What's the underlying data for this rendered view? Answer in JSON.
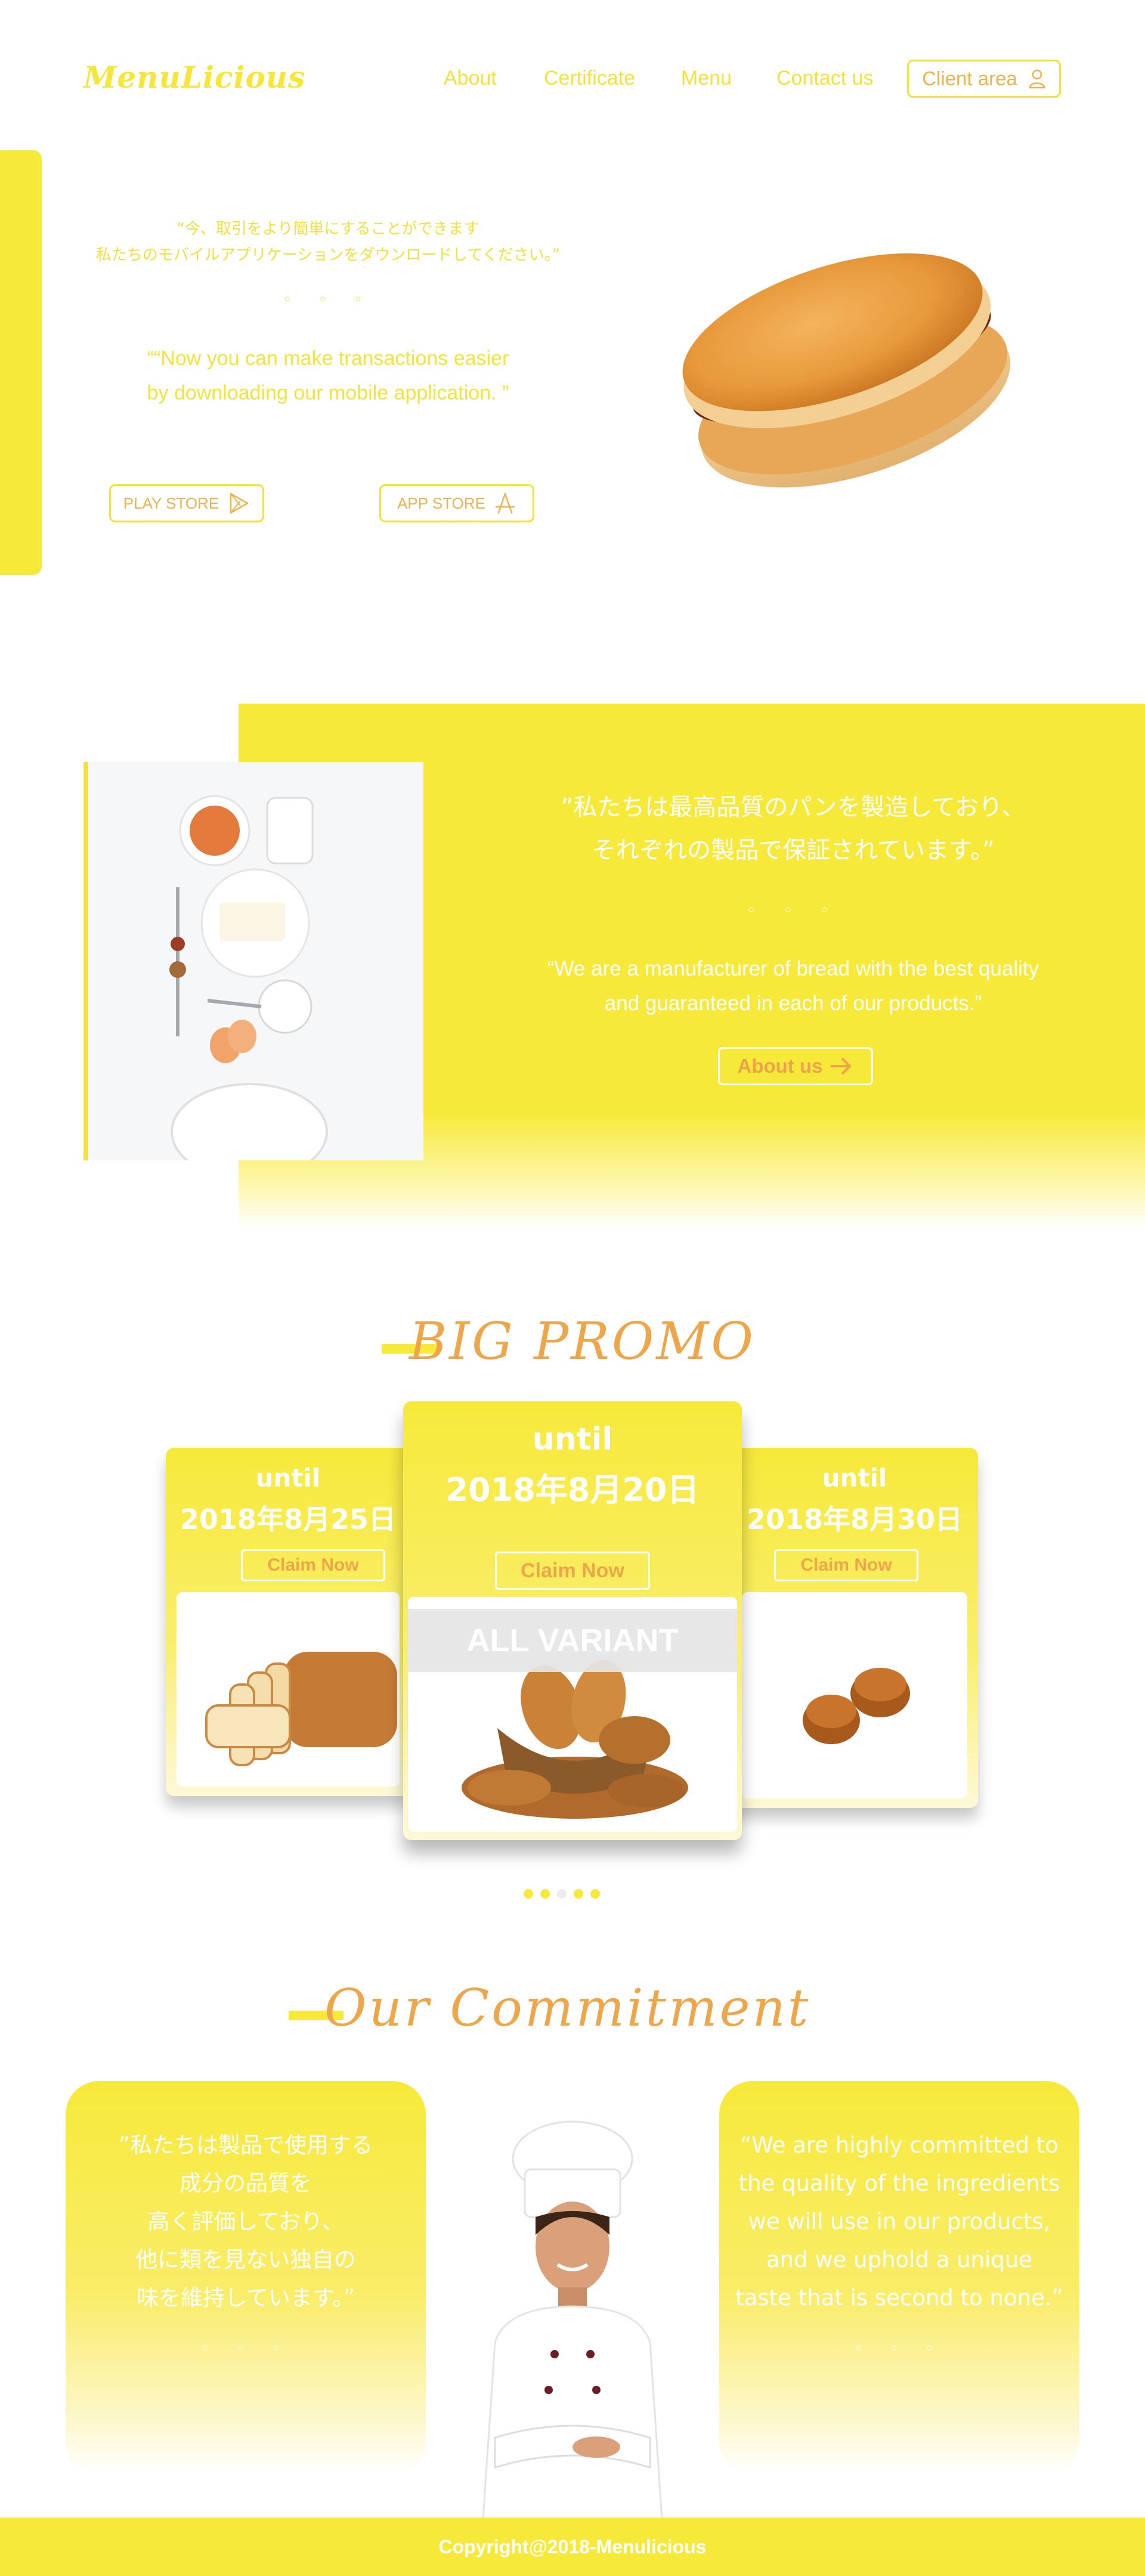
{
  "nav": {
    "logo": "MenuLicious",
    "links": [
      "About",
      "Certificate",
      "Menu",
      "Contact us"
    ],
    "client_area": "Client area"
  },
  "hero": {
    "jp_line1": "“今、取引をより簡単にすることができます",
    "jp_line2": "私たちのモバイルアプリケーションをダウンロードしてください。”",
    "dots": "◦ ◦ ◦",
    "en_line1": "““Now you can make transactions easier",
    "en_line2": "by downloading our mobile application. ”",
    "play_store": "PLAY STORE",
    "app_store": "APP STORE"
  },
  "about": {
    "jp_line1": "”私たちは最高品質のパンを製造しており、",
    "jp_line2": "それぞれの製品で保証されています。”",
    "dots": "◦ ◦ ◦",
    "en_line1": "“We are a manufacturer of bread with the best quality",
    "en_line2": "and guaranteed in each of our products.”",
    "button": "About us"
  },
  "promo": {
    "title": "BIG PROMO",
    "cards": [
      {
        "until": "until",
        "date": "2018年8月25日",
        "claim": "Claim Now"
      },
      {
        "until": "until",
        "date": "2018年8月20日",
        "claim": "Claim Now",
        "label": "ALL VARIANT"
      },
      {
        "until": "until",
        "date": "2018年8月30日",
        "claim": "Claim Now"
      }
    ],
    "pager_count": 5,
    "pager_active": 2
  },
  "commitment": {
    "title": "Our Commitment",
    "jp_lines": [
      "”私たちは製品で使用する",
      "成分の品質を",
      "高く評価しており、",
      "他に類を見ない独自の",
      "味を維持しています。”"
    ],
    "en_lines": [
      "“We are highly committed to",
      "the quality of the ingredients",
      "we will use in our products,",
      "and we uphold a unique",
      "taste that is second to none.”"
    ],
    "dots": "◦ ◦ ◦"
  },
  "footer": {
    "copyright": "Copyright@2018-Menulicious"
  },
  "colors": {
    "brand_yellow": "#f7e93a",
    "accent_orange": "#eea64a",
    "text_white": "#ffffff"
  }
}
